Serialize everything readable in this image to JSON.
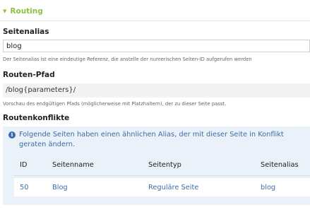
{
  "section": {
    "title": "Routing",
    "collapse_icon": "triangle-down-icon"
  },
  "alias": {
    "label": "Seitenalias",
    "value": "blog",
    "help": "Der Seitenalias ist eine eindeutige Referenz, die anstelle der numerischen Seiten-ID aufgerufen werden"
  },
  "route": {
    "label": "Routen-Pfad",
    "value": "/blog{parameters}/",
    "help": "Vorschau des endgültigen Pfads (möglicherweise mit Platzhaltern), der zu dieser Seite passt."
  },
  "conflicts": {
    "label": "Routenkonflikte",
    "info_icon": "info-icon",
    "message": "Folgende Seiten haben einen ähnlichen Alias, der mit dieser Seite in Konflikt geraten ändern.",
    "columns": [
      "ID",
      "Seitenname",
      "Seitentyp",
      "Seitenalias"
    ],
    "rows": [
      {
        "id": "50",
        "name": "Blog",
        "type": "Reguläre Seite",
        "alias": "blog"
      }
    ]
  },
  "colors": {
    "accent_green": "#8fc23f",
    "link_blue": "#3b6ea8",
    "alert_bg": "#eaf1f8"
  }
}
